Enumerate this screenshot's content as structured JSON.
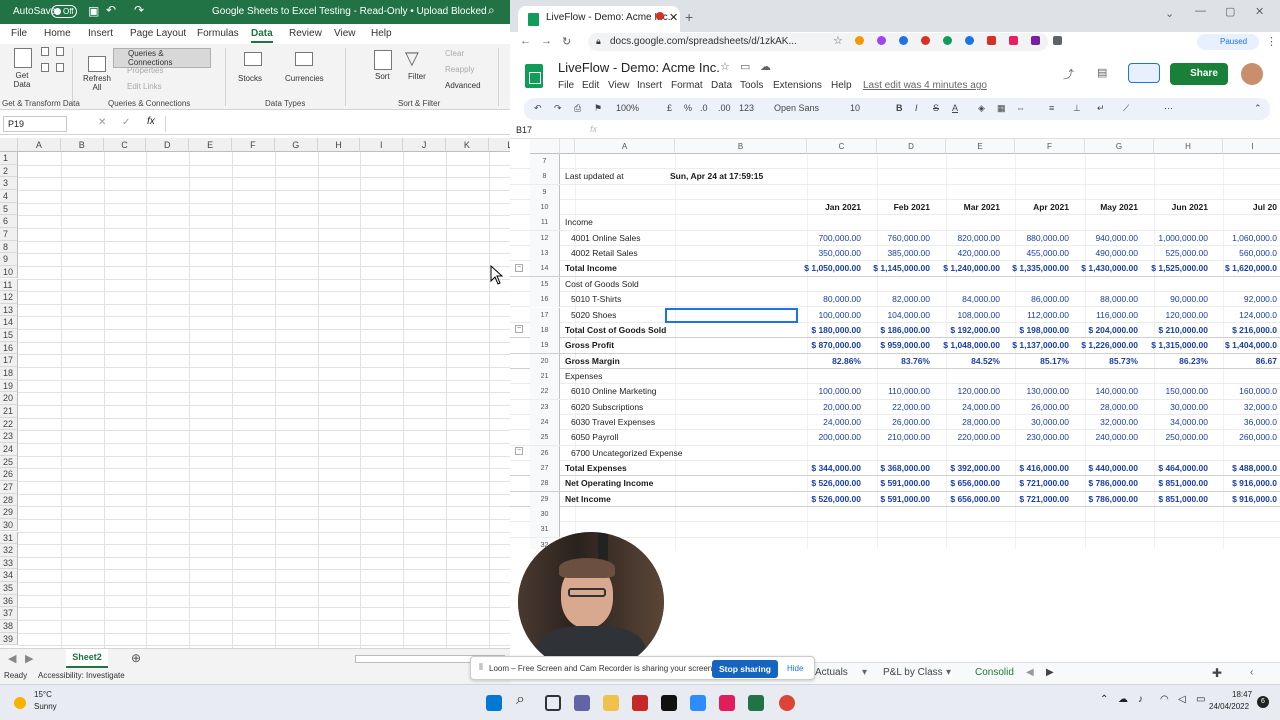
{
  "excel": {
    "autosave": "AutoSave",
    "toggle": "Off",
    "title": "Google Sheets to Excel Testing  -  Read-Only • Upload Blocked",
    "tabs": [
      "File",
      "Home",
      "Insert",
      "Page Layout",
      "Formulas",
      "Data",
      "Review",
      "View",
      "Help"
    ],
    "active_tab": "Data",
    "ribbon": {
      "get_data": "Get Data",
      "refresh_all": "Refresh All",
      "queries_connections": "Queries & Connections",
      "properties": "Properties",
      "edit_links": "Edit Links",
      "stocks": "Stocks",
      "currencies": "Currencies",
      "sort": "Sort",
      "filter": "Filter",
      "clear": "Clear",
      "reapply": "Reapply",
      "advanced": "Advanced",
      "group_get_transform": "Get & Transform Data",
      "group_queries": "Queries & Connections",
      "group_data_types": "Data Types",
      "group_sort_filter": "Sort & Filter"
    },
    "name_box": "P19",
    "columns": [
      "A",
      "B",
      "C",
      "D",
      "E",
      "F",
      "G",
      "H",
      "I",
      "J",
      "K",
      "L"
    ],
    "rows": [
      "1",
      "2",
      "3",
      "4",
      "5",
      "6",
      "7",
      "8",
      "9",
      "10",
      "11",
      "12",
      "13",
      "14",
      "15",
      "16",
      "17",
      "18",
      "19",
      "20",
      "21",
      "22",
      "23",
      "24",
      "25",
      "26",
      "27",
      "28",
      "29",
      "30",
      "31",
      "32",
      "33",
      "34",
      "35",
      "36",
      "37",
      "38",
      "39"
    ],
    "sheet_tab": "Sheet2",
    "status_ready": "Ready",
    "status_accessibility": "Accessibility: Investigate"
  },
  "chrome": {
    "tab_title": "LiveFlow - Demo: Acme Inc.",
    "url": "docs.google.com/spreadsheets/d/1zkAK...",
    "paused": "Paused"
  },
  "sheets": {
    "doc_title": "LiveFlow - Demo: Acme Inc.",
    "menu": [
      "File",
      "Edit",
      "View",
      "Insert",
      "Format",
      "Data",
      "Tools",
      "Extensions",
      "Help"
    ],
    "last_edit": "Last edit was 4 minutes ago",
    "share": "Share",
    "zoom": "100%",
    "currency_symbol": "£",
    "percent_symbol": "%",
    "dec_less": ".0",
    "dec_more": ".00",
    "format_123": "123",
    "font": "Open Sans",
    "font_size": "10",
    "cell_ref": "B17",
    "col_headers": [
      "A",
      "B",
      "C",
      "D",
      "E",
      "F",
      "G",
      "H",
      "I"
    ],
    "last_updated_label": "Last updated at",
    "last_updated_value": "Sun, Apr 24 at 17:59:15",
    "months": [
      "Jan 2021",
      "Feb 2021",
      "Mar 2021",
      "Apr 2021",
      "May 2021",
      "Jun 2021",
      "Jul 20"
    ],
    "rows": [
      {
        "n": "7",
        "label": "",
        "vals": [],
        "style": "plain"
      },
      {
        "n": "8",
        "label": "",
        "vals": [],
        "style": "plain"
      },
      {
        "n": "9",
        "label": "",
        "vals": [],
        "style": "plain"
      },
      {
        "n": "10",
        "label": "",
        "vals": [],
        "style": "plain"
      },
      {
        "n": "11",
        "label": "Income",
        "vals": [],
        "style": "section"
      },
      {
        "n": "12",
        "label": "4001 Online Sales",
        "vals": [
          "700,000.00",
          "760,000.00",
          "820,000.00",
          "880,000.00",
          "940,000.00",
          "1,000,000.00",
          "1,060,000.0"
        ],
        "style": "item"
      },
      {
        "n": "13",
        "label": "4002 Retail Sales",
        "vals": [
          "350,000.00",
          "385,000.00",
          "420,000.00",
          "455,000.00",
          "490,000.00",
          "525,000.00",
          "560,000.0"
        ],
        "style": "item"
      },
      {
        "n": "14",
        "label": "Total Income",
        "vals": [
          "$ 1,050,000.00",
          "$ 1,145,000.00",
          "$ 1,240,000.00",
          "$ 1,335,000.00",
          "$ 1,430,000.00",
          "$ 1,525,000.00",
          "$ 1,620,000.0"
        ],
        "style": "total"
      },
      {
        "n": "15",
        "label": "Cost of Goods Sold",
        "vals": [],
        "style": "section"
      },
      {
        "n": "16",
        "label": "5010 T-Shirts",
        "vals": [
          "80,000.00",
          "82,000.00",
          "84,000.00",
          "86,000.00",
          "88,000.00",
          "90,000.00",
          "92,000.0"
        ],
        "style": "item"
      },
      {
        "n": "17",
        "label": "5020 Shoes",
        "vals": [
          "100,000.00",
          "104,000.00",
          "108,000.00",
          "112,000.00",
          "116,000.00",
          "120,000.00",
          "124,000.0"
        ],
        "style": "item"
      },
      {
        "n": "18",
        "label": "Total Cost of Goods Sold",
        "vals": [
          "$ 180,000.00",
          "$ 186,000.00",
          "$ 192,000.00",
          "$ 198,000.00",
          "$ 204,000.00",
          "$ 210,000.00",
          "$ 216,000.0"
        ],
        "style": "total"
      },
      {
        "n": "19",
        "label": "Gross Profit",
        "vals": [
          "$ 870,000.00",
          "$ 959,000.00",
          "$ 1,048,000.00",
          "$ 1,137,000.00",
          "$ 1,226,000.00",
          "$ 1,315,000.00",
          "$ 1,404,000.0"
        ],
        "style": "total"
      },
      {
        "n": "20",
        "label": "Gross Margin",
        "vals": [
          "82.86%",
          "83.76%",
          "84.52%",
          "85.17%",
          "85.73%",
          "86.23%",
          "86.67"
        ],
        "style": "total"
      },
      {
        "n": "21",
        "label": "Expenses",
        "vals": [],
        "style": "section"
      },
      {
        "n": "22",
        "label": "6010 Online Marketing",
        "vals": [
          "100,000.00",
          "110,000.00",
          "120,000.00",
          "130,000.00",
          "140,000.00",
          "150,000.00",
          "160,000.0"
        ],
        "style": "item"
      },
      {
        "n": "23",
        "label": "6020 Subscriptions",
        "vals": [
          "20,000.00",
          "22,000.00",
          "24,000.00",
          "26,000.00",
          "28,000.00",
          "30,000.00",
          "32,000.0"
        ],
        "style": "item"
      },
      {
        "n": "24",
        "label": "6030 Travel Expenses",
        "vals": [
          "24,000.00",
          "26,000.00",
          "28,000.00",
          "30,000.00",
          "32,000.00",
          "34,000.00",
          "36,000.0"
        ],
        "style": "item"
      },
      {
        "n": "25",
        "label": "6050 Payroll",
        "vals": [
          "200,000.00",
          "210,000.00",
          "220,000.00",
          "230,000.00",
          "240,000.00",
          "250,000.00",
          "260,000.0"
        ],
        "style": "item"
      },
      {
        "n": "26",
        "label": "6700 Uncategorized Expense",
        "vals": [],
        "style": "item"
      },
      {
        "n": "27",
        "label": "Total Expenses",
        "vals": [
          "$ 344,000.00",
          "$ 368,000.00",
          "$ 392,000.00",
          "$ 416,000.00",
          "$ 440,000.00",
          "$ 464,000.00",
          "$ 488,000.0"
        ],
        "style": "total"
      },
      {
        "n": "28",
        "label": "Net Operating Income",
        "vals": [
          "$ 526,000.00",
          "$ 591,000.00",
          "$ 656,000.00",
          "$ 721,000.00",
          "$ 786,000.00",
          "$ 851,000.00",
          "$ 916,000.0"
        ],
        "style": "total"
      },
      {
        "n": "29",
        "label": "Net Income",
        "vals": [
          "$ 526,000.00",
          "$ 591,000.00",
          "$ 656,000.00",
          "$ 721,000.00",
          "$ 786,000.00",
          "$ 851,000.00",
          "$ 916,000.0"
        ],
        "style": "total"
      },
      {
        "n": "30",
        "label": "",
        "vals": [],
        "style": "plain"
      },
      {
        "n": "31",
        "label": "",
        "vals": [],
        "style": "plain"
      },
      {
        "n": "32",
        "label": "",
        "vals": [],
        "style": "plain"
      }
    ],
    "sheet_tabs": [
      ". Actuals",
      "P&L by Class",
      "Consolid"
    ]
  },
  "loom": {
    "message": "Loom – Free Screen and Cam Recorder is sharing your screen.",
    "stop": "Stop sharing",
    "hide": "Hide"
  },
  "taskbar": {
    "temp": "15°C",
    "weather": "Sunny",
    "time": "18:47",
    "date": "24/04/2022",
    "notif_count": "6"
  },
  "colors": {
    "excel_green": "#217346",
    "sheets_green": "#0f9d58",
    "share_green": "#188038",
    "link_blue": "#1a73e8"
  }
}
